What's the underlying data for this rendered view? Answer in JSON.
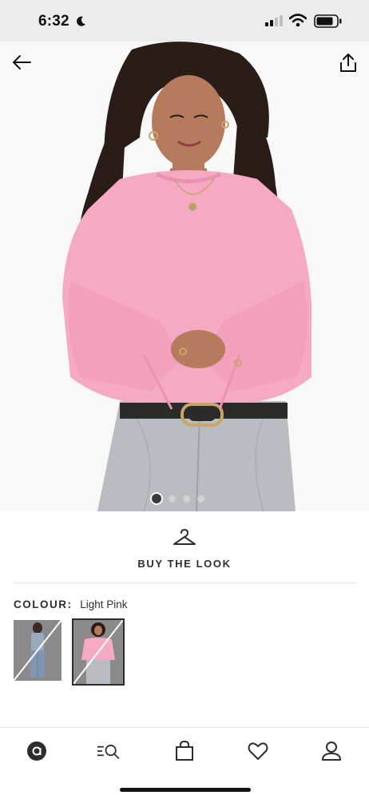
{
  "status_bar": {
    "time": "6:32"
  },
  "product": {
    "image_count": 4,
    "active_image_index": 1
  },
  "buy_the_look": {
    "label": "BUY THE LOOK"
  },
  "colour": {
    "label": "COLOUR:",
    "value": "Light Pink"
  },
  "swatches": [
    {
      "name": "swatch-denim",
      "selected": false
    },
    {
      "name": "swatch-light-pink",
      "selected": true
    }
  ],
  "bottom_nav": {
    "items": [
      {
        "icon": "home-logo-icon"
      },
      {
        "icon": "search-icon"
      },
      {
        "icon": "bag-icon"
      },
      {
        "icon": "heart-icon"
      },
      {
        "icon": "account-icon"
      }
    ]
  },
  "colors": {
    "text": "#2d2d2d",
    "status_bar_bg": "#ececec",
    "sweater_pink": "#f5a9c3",
    "divider": "#e6e6e6"
  }
}
